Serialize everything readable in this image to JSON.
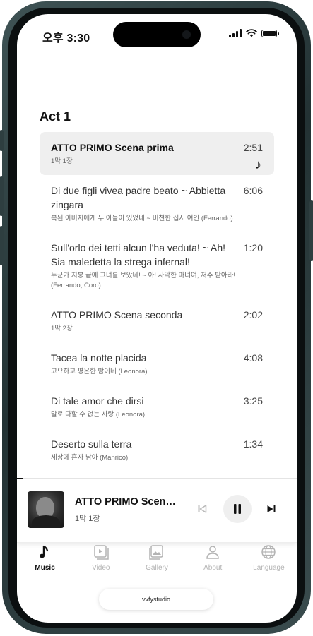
{
  "status_bar": {
    "time": "오후 3:30"
  },
  "section": {
    "title": "Act 1"
  },
  "tracks": [
    {
      "title": "ATTO PRIMO Scena prima",
      "subtitle": "1막 1장",
      "duration": "2:51",
      "active": true
    },
    {
      "title": "Di due figli vivea padre beato ~ Abbietta zingara",
      "subtitle": "복된 아버지에게 두 아들이 있었네 ~ 비천한 집시 여인 (Ferrando)",
      "duration": "6:06"
    },
    {
      "title": "Sull'orlo dei tetti alcun l'ha veduta! ~ Ah! Sia maledetta la strega infernal!",
      "subtitle": "누군가 지붕 끝에 그녀를 보았네! ~ 아! 사악한 마녀여, 저주 받아라! (Ferrando, Coro)",
      "duration": "1:20"
    },
    {
      "title": "ATTO PRIMO Scena seconda",
      "subtitle": "1막 2장",
      "duration": "2:02"
    },
    {
      "title": "Tacea la notte placida",
      "subtitle": "고요하고 평온한 밤이네 (Leonora)",
      "duration": "4:08"
    },
    {
      "title": "Di tale amor che dirsi",
      "subtitle": "말로 다할 수 없는 사랑 (Leonora)",
      "duration": "3:25"
    },
    {
      "title": "Deserto sulla terra",
      "subtitle": "세상에 혼자 남아 (Manrico)",
      "duration": "1:34"
    }
  ],
  "now_playing": {
    "title": "ATTO PRIMO Scena ...",
    "subtitle": "1막 1장",
    "progress": 0.02
  },
  "tabs": [
    {
      "label": "Music",
      "icon": "music-note-icon",
      "active": true
    },
    {
      "label": "Video",
      "icon": "video-icon"
    },
    {
      "label": "Gallery",
      "icon": "gallery-icon"
    },
    {
      "label": "About",
      "icon": "person-icon"
    },
    {
      "label": "Language",
      "icon": "globe-icon"
    }
  ],
  "brand": {
    "label": "vvfystudio"
  }
}
